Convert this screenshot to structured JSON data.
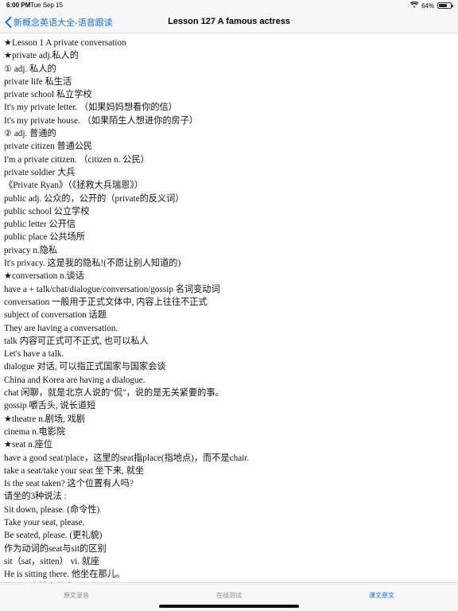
{
  "status": {
    "time": "6:00 PM",
    "date": "Tue Sep 15",
    "wifi_icon": "wifi-icon",
    "battery": "64%",
    "battery_level": 0.64
  },
  "nav": {
    "back_label": "新概念英语大全-语音跟读",
    "title": "Lesson 127 A famous actress"
  },
  "lines": [
    "★Lesson 1    A private conversation",
    "★private   adj.私人的",
    "① adj. 私人的",
    "private life  私生活",
    "private school  私立学校",
    "It's my private letter.   （如果妈妈想看你的信）",
    "It's my private house.   （如果陌生人想进你的房子）",
    "② adj. 普通的",
    "private citizen  普通公民",
    "I'm a private citizen.    （citizen  n. 公民）",
    "private soldier 大兵",
    "《Private Ryan》（《拯救大兵瑞恩》）",
    "public  adj. 公众的，公开的（private的反义词）",
    "public school   公立学校",
    "public letter   公开信",
    "public place   公共场所",
    "privacy    n.隐私",
    "It's privacy.   这是我的隐私!(不愿让别人知道的)",
    "★conversation    n.谈话",
    "have a + talk/chat/dialogue/conversation/gossip 名词变动词",
    "conversation  一般用于正式文体中, 内容上往往不正式",
    "subject of conversation   话题",
    "They are having a conversation.",
    "talk 内容可正式可不正式, 也可以私人",
    "Let's have a talk.",
    "dialogue 对话, 可以指正式国家与国家会谈",
    "China and Korea are having a dialogue.",
    "chat 闲聊，就是北京人说的\"侃\"，说的是无关紧要的事。",
    "gossip 嚼舌头, 说长道短",
    "★theatre    n.剧场, 戏剧",
    "cinema    n.电影院",
    "★seat    n.座位",
    "have a good seat/place，这里的seat指place(指地点)，而不是chair.",
    "take a seat/take your seat  坐下来, 就坐",
    "Is the seat taken?  这个位置有人吗?",
    "请坐的3种说法 :",
    "Sit down, please.  (命令性)",
    "Take your seat, please.",
    "Be seated, please.  (更礼貌)",
    "作为动词的seat与sit的区别",
    "sit（sat，sitten）  vi. 就座",
    "He is sitting there.   他坐在那儿。",
    "seat  vt.让某人就座"
  ],
  "tabs": [
    {
      "label": "原文录音"
    },
    {
      "label": "在线测试"
    },
    {
      "label": "课文原文"
    }
  ]
}
